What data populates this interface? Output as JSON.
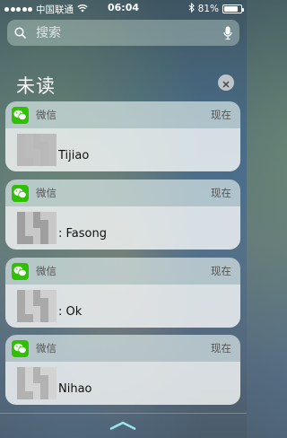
{
  "status_bar": {
    "carrier": "中国联通",
    "time": "06:04",
    "battery_percent": "81%",
    "battery_level": 0.81
  },
  "search": {
    "placeholder": "搜索"
  },
  "section": {
    "title": "未读"
  },
  "notifications": [
    {
      "app_name": "微信",
      "time": "现在",
      "message": "Tijiao"
    },
    {
      "app_name": "微信",
      "time": "现在",
      "message": ": Fasong"
    },
    {
      "app_name": "微信",
      "time": "现在",
      "message": ": Ok"
    },
    {
      "app_name": "微信",
      "time": "现在",
      "message": "Nihao"
    }
  ],
  "colors": {
    "wechat_green": "#2dc100"
  },
  "icons": {
    "search": "search-icon",
    "mic": "microphone-icon",
    "clear": "close-icon",
    "app": "wechat-icon",
    "handle": "chevron-up-icon"
  }
}
